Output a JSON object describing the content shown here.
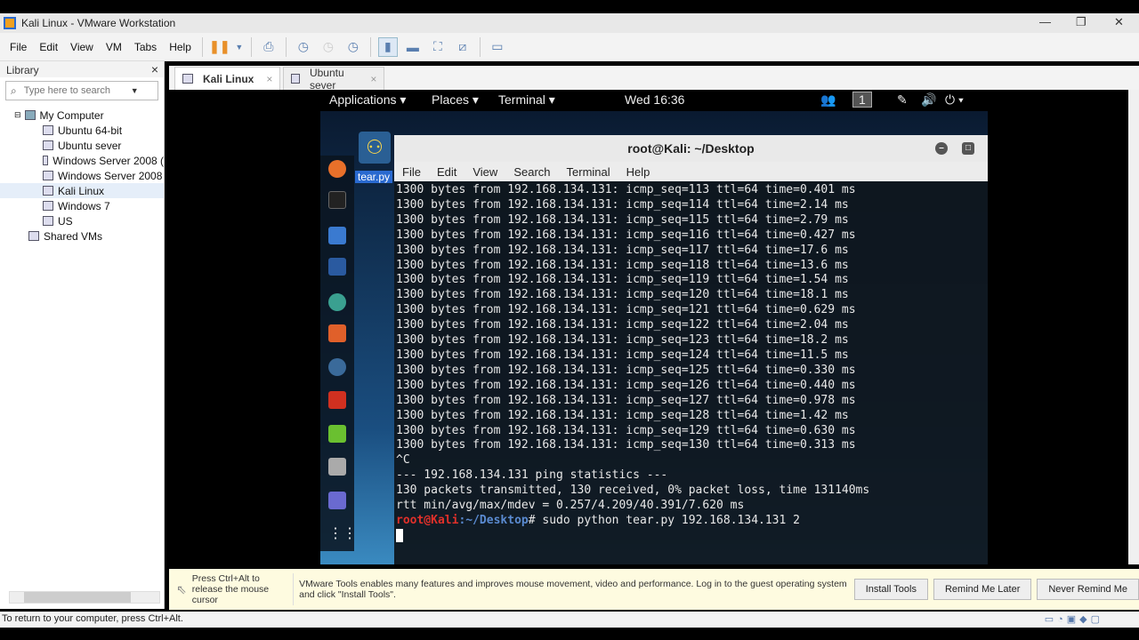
{
  "window": {
    "title": "Kali Linux - VMware Workstation",
    "minimize": "—",
    "restore": "❐",
    "close": "✕"
  },
  "menu": [
    "File",
    "Edit",
    "View",
    "VM",
    "Tabs",
    "Help"
  ],
  "library": {
    "title": "Library",
    "close": "×",
    "search_placeholder": "Type here to search",
    "tree": [
      "My Computer",
      "Ubuntu 64-bit",
      "Ubuntu sever",
      "Windows Server 2008 (",
      "Windows Server 2008",
      "Kali Linux",
      "Windows 7",
      "US",
      "Shared VMs"
    ]
  },
  "tabs": [
    {
      "label": "Kali Linux"
    },
    {
      "label": "Ubuntu sever"
    }
  ],
  "kali": {
    "applications": "Applications ▾",
    "places": "Places ▾",
    "terminal": "Terminal ▾",
    "clock": "Wed 16:36",
    "workspace": "1",
    "desktop_file": "tear.py"
  },
  "terminal": {
    "title": "root@Kali: ~/Desktop",
    "menu": [
      "File",
      "Edit",
      "View",
      "Search",
      "Terminal",
      "Help"
    ],
    "ping_lines": [
      "1300 bytes from 192.168.134.131: icmp_seq=113 ttl=64 time=0.401 ms",
      "1300 bytes from 192.168.134.131: icmp_seq=114 ttl=64 time=2.14 ms",
      "1300 bytes from 192.168.134.131: icmp_seq=115 ttl=64 time=2.79 ms",
      "1300 bytes from 192.168.134.131: icmp_seq=116 ttl=64 time=0.427 ms",
      "1300 bytes from 192.168.134.131: icmp_seq=117 ttl=64 time=17.6 ms",
      "1300 bytes from 192.168.134.131: icmp_seq=118 ttl=64 time=13.6 ms",
      "1300 bytes from 192.168.134.131: icmp_seq=119 ttl=64 time=1.54 ms",
      "1300 bytes from 192.168.134.131: icmp_seq=120 ttl=64 time=18.1 ms",
      "1300 bytes from 192.168.134.131: icmp_seq=121 ttl=64 time=0.629 ms",
      "1300 bytes from 192.168.134.131: icmp_seq=122 ttl=64 time=2.04 ms",
      "1300 bytes from 192.168.134.131: icmp_seq=123 ttl=64 time=18.2 ms",
      "1300 bytes from 192.168.134.131: icmp_seq=124 ttl=64 time=11.5 ms",
      "1300 bytes from 192.168.134.131: icmp_seq=125 ttl=64 time=0.330 ms",
      "1300 bytes from 192.168.134.131: icmp_seq=126 ttl=64 time=0.440 ms",
      "1300 bytes from 192.168.134.131: icmp_seq=127 ttl=64 time=0.978 ms",
      "1300 bytes from 192.168.134.131: icmp_seq=128 ttl=64 time=1.42 ms",
      "1300 bytes from 192.168.134.131: icmp_seq=129 ttl=64 time=0.630 ms",
      "1300 bytes from 192.168.134.131: icmp_seq=130 ttl=64 time=0.313 ms"
    ],
    "interrupt": "^C",
    "stats_header": "--- 192.168.134.131 ping statistics ---",
    "stats_packets": "130 packets transmitted, 130 received, 0% packet loss, time 131140ms",
    "stats_rtt": "rtt min/avg/max/mdev = 0.257/4.209/40.391/7.620 ms",
    "prompt_user": "root@Kali",
    "prompt_path": ":~/Desktop",
    "prompt_command": "# sudo python tear.py 192.168.134.131 2"
  },
  "notification": {
    "hint": "Press Ctrl+Alt to release the mouse cursor",
    "message": "VMware Tools enables many features and improves mouse movement, video and performance. Log in to the guest operating system and click \"Install Tools\".",
    "install": "Install Tools",
    "remind": "Remind Me Later",
    "never": "Never Remind Me"
  },
  "status": "To return to your computer, press Ctrl+Alt."
}
